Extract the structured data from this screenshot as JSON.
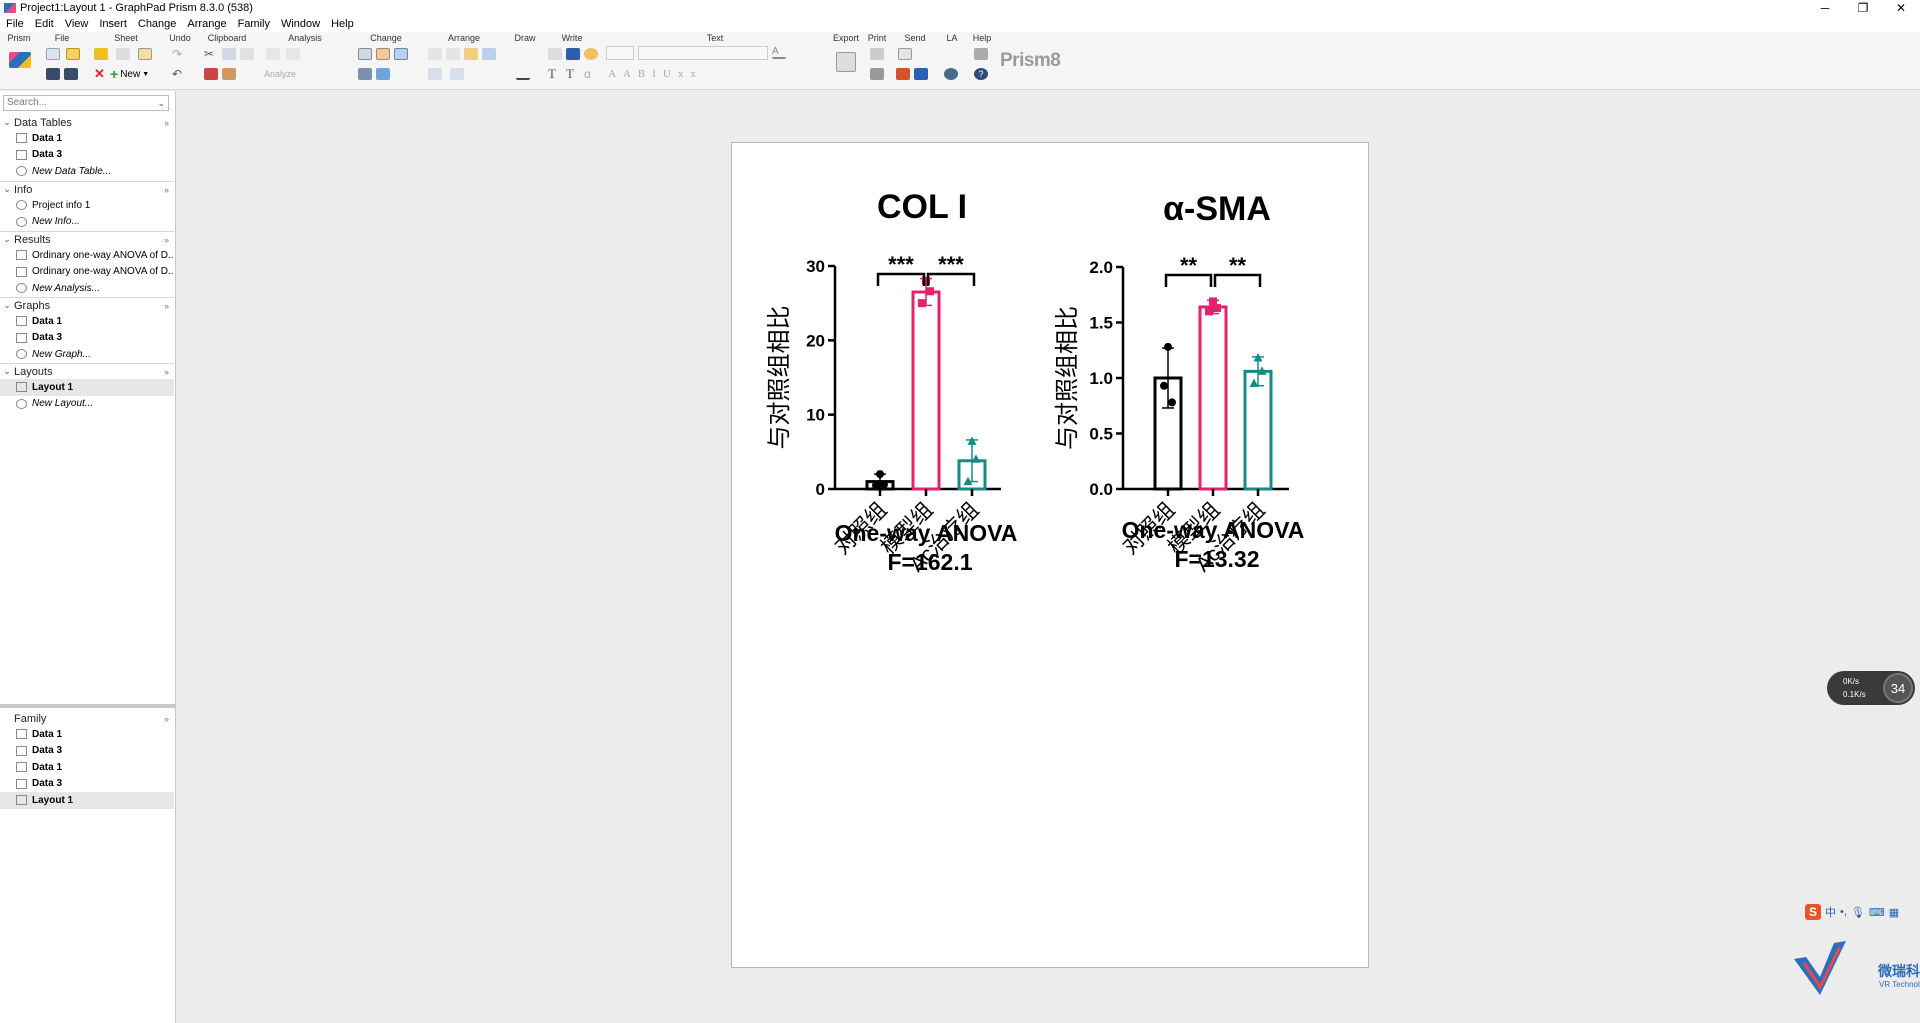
{
  "window": {
    "title": "Project1:Layout 1 - GraphPad Prism 8.3.0 (538)"
  },
  "menu": [
    "File",
    "Edit",
    "View",
    "Insert",
    "Change",
    "Arrange",
    "Family",
    "Window",
    "Help"
  ],
  "ribbon": {
    "groups": [
      "Prism",
      "File",
      "Sheet",
      "Undo",
      "Clipboard",
      "Analysis",
      "Change",
      "Arrange",
      "Draw",
      "Write",
      "Text",
      "Export",
      "Print",
      "Send",
      "LA",
      "Help"
    ],
    "new_label": "New",
    "analyze_label": "Analyze",
    "logo": "Prism8"
  },
  "search": {
    "placeholder": "Search..."
  },
  "navigator": {
    "data_tables": {
      "header": "Data Tables",
      "items": [
        "Data 1",
        "Data 3"
      ],
      "new": "New Data Table..."
    },
    "info": {
      "header": "Info",
      "items": [
        "Project info 1"
      ],
      "new": "New Info..."
    },
    "results": {
      "header": "Results",
      "items": [
        "Ordinary one-way ANOVA of D...",
        "Ordinary one-way ANOVA of D..."
      ],
      "new": "New Analysis..."
    },
    "graphs": {
      "header": "Graphs",
      "items": [
        "Data 1",
        "Data 3"
      ],
      "new": "New Graph..."
    },
    "layouts": {
      "header": "Layouts",
      "items": [
        "Layout 1"
      ],
      "new": "New Layout..."
    }
  },
  "family": {
    "header": "Family",
    "items": [
      "Data 1",
      "Data 3",
      "Data 1",
      "Data 3",
      "Layout 1"
    ]
  },
  "colors": {
    "control": "#000000",
    "model": "#e6206e",
    "treat": "#1a8a87"
  },
  "chart_data": [
    {
      "type": "bar",
      "title": "COL I",
      "ylabel": "与对照组相比",
      "categories": [
        "对照组",
        "模型组",
        "Ac治疗组"
      ],
      "values": [
        1.0,
        26.5,
        3.8
      ],
      "sd": [
        1.0,
        1.8,
        2.8
      ],
      "points": [
        [
          2.0,
          0.5,
          0.6
        ],
        [
          28.0,
          25.0,
          26.6
        ],
        [
          6.4,
          1.0,
          4.0
        ]
      ],
      "markers": [
        "circle",
        "square",
        "triangle"
      ],
      "ylim": [
        0,
        30
      ],
      "yticks": [
        "0",
        "10",
        "20",
        "30"
      ],
      "significance": [
        "***",
        "***"
      ],
      "stat_line1": "One-way ANOVA",
      "stat_line2": "F=162.1"
    },
    {
      "type": "bar",
      "title": "α-SMA",
      "ylabel": "与对照组相比",
      "categories": [
        "对照组",
        "模型组",
        "Ac治疗组"
      ],
      "values": [
        1.0,
        1.64,
        1.06
      ],
      "sd": [
        0.27,
        0.06,
        0.13
      ],
      "points": [
        [
          1.28,
          0.93,
          0.78
        ],
        [
          1.69,
          1.6,
          1.63
        ],
        [
          1.18,
          0.95,
          1.06
        ]
      ],
      "markers": [
        "circle",
        "square",
        "triangle"
      ],
      "ylim": [
        0,
        2.0
      ],
      "yticks": [
        "0.0",
        "0.5",
        "1.0",
        "1.5",
        "2.0"
      ],
      "significance": [
        "**",
        "**"
      ],
      "stat_line1": "One-way ANOVA",
      "stat_line2": "F=13.32"
    }
  ],
  "widget": {
    "up": "0K/s",
    "down": "0.1K/s",
    "pct": "34"
  },
  "ime": {
    "lang": "中"
  },
  "watermark": {
    "name": "微瑞科技",
    "sub": "VR Technology"
  }
}
